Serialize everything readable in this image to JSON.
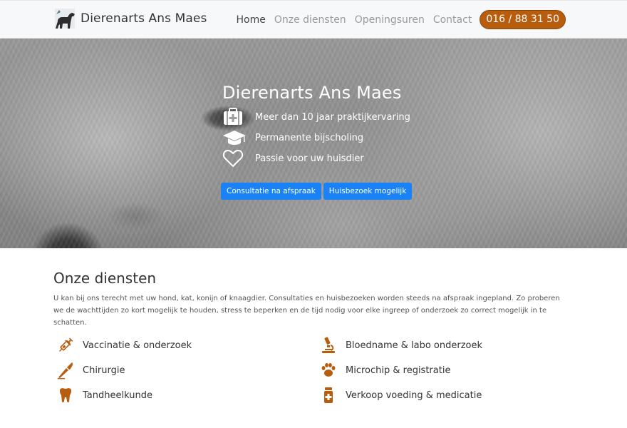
{
  "colors": {
    "accent": "#b85c0e",
    "button_blue": "#1a82f7",
    "nav_bg": "#f7f8f9"
  },
  "brand": {
    "logo_icon": "dog-icon",
    "title": "Dierenarts Ans Maes"
  },
  "nav": {
    "items": [
      {
        "label": "Home",
        "active": true
      },
      {
        "label": "Onze diensten",
        "active": false
      },
      {
        "label": "Openingsuren",
        "active": false
      },
      {
        "label": "Contact",
        "active": false
      }
    ],
    "phone": "016 / 88 31 50"
  },
  "hero": {
    "title": "Dierenarts Ans Maes",
    "items": [
      {
        "icon": "medkit-icon",
        "label": "Meer dan 10 jaar praktijkervaring"
      },
      {
        "icon": "graduation-cap-icon",
        "label": "Permanente bijscholing"
      },
      {
        "icon": "heart-icon",
        "label": "Passie voor uw huisdier"
      }
    ],
    "buttons": [
      {
        "label": "Consultatie na afspraak"
      },
      {
        "label": "Huisbezoek mogelijk"
      }
    ]
  },
  "services": {
    "title": "Onze diensten",
    "text": "U kan bij ons terecht met uw hond, kat, konijn of knaagdier. Consultaties en huisbezoeken worden steeds na afspraak ingepland. Zo proberen we de wachttijden zo kort mogelijk te houden, stress te beperken en de tijd nodig voor elke ingreep of onderzoek zo correct mogelijk in te schatten.",
    "items": [
      {
        "icon": "syringe-icon",
        "label": "Vaccinatie & onderzoek"
      },
      {
        "icon": "microscope-icon",
        "label": "Bloedname & labo onderzoek"
      },
      {
        "icon": "scalpel-icon",
        "label": "Chirurgie"
      },
      {
        "icon": "paw-icon",
        "label": "Microchip & registratie"
      },
      {
        "icon": "tooth-icon",
        "label": "Tandheelkunde"
      },
      {
        "icon": "pill-bottle-icon",
        "label": "Verkoop voeding & medicatie"
      }
    ]
  }
}
